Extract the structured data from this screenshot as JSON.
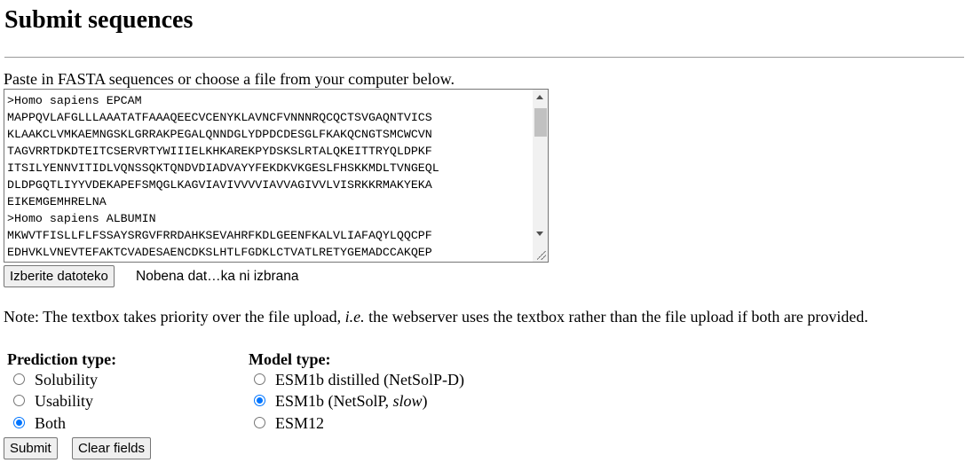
{
  "page": {
    "title": "Submit sequences",
    "intro": "Paste in FASTA sequences or choose a file from your computer below."
  },
  "sequence_box": {
    "value": ">Homo sapiens EPCAM\nMAPPQVLAFGLLLAAATATFAAAQEECVCENYKLAVNCFVNNNRQCQCTSVGAQNTVICS\nKLAAKCLVMKAEMNGSKLGRRAKPEGALQNNDGLYDPDCDESGLFKAKQCNGTSMCWCVN\nTAGVRRTDKDTEITCSERVRTYWIIIELKHKAREKPYDSKSLRTALQKEITTRYQLDPKF\nITSILYENNVITIDLVQNSSQKTQNDVDIADVAYYFEKDKVKGESLFHSKKMDLTVNGEQL\nDLDPGQTLIYYVDEKAPEFSMQGLKAGVIAVIVVVVIAVVAGIVVLVISRKKRMAKYEKA\nEIKEMGEMHRELNA\n>Homo sapiens ALBUMIN\nMKWVTFISLLFLFSSAYSRGVFRRDAHKSEVAHRFKDLGEENFKALVLIAFAQYLQQCPF\nEDHVKLVNEVTEFAKTCVADESAENCDKSLHTLFGDKLCTVATLRETYGEMADCCAKQEP"
  },
  "file_upload": {
    "button_label": "Izberite datoteko",
    "status": "Nobena dat…ka ni izbrana"
  },
  "note": {
    "before": "Note: The textbox takes priority over the file upload, ",
    "ie": "i.e.",
    "after": " the webserver uses the textbox rather than the file upload if both are provided."
  },
  "prediction_type": {
    "label": "Prediction type:",
    "options": [
      {
        "label": "Solubility",
        "checked": false
      },
      {
        "label": "Usability",
        "checked": false
      },
      {
        "label": "Both",
        "checked": true
      }
    ]
  },
  "model_type": {
    "label": "Model type:",
    "options": [
      {
        "label": "ESM1b distilled (NetSolP-D)",
        "checked": false
      },
      {
        "label_main": "ESM1b (NetSolP, ",
        "label_em": "slow",
        "label_end": ")",
        "checked": true
      },
      {
        "label": "ESM12",
        "checked": false
      }
    ]
  },
  "actions": {
    "submit_label": "Submit",
    "clear_label": "Clear fields"
  },
  "colors": {
    "radio_checked": "#0075ff",
    "button_bg": "#efefef"
  }
}
